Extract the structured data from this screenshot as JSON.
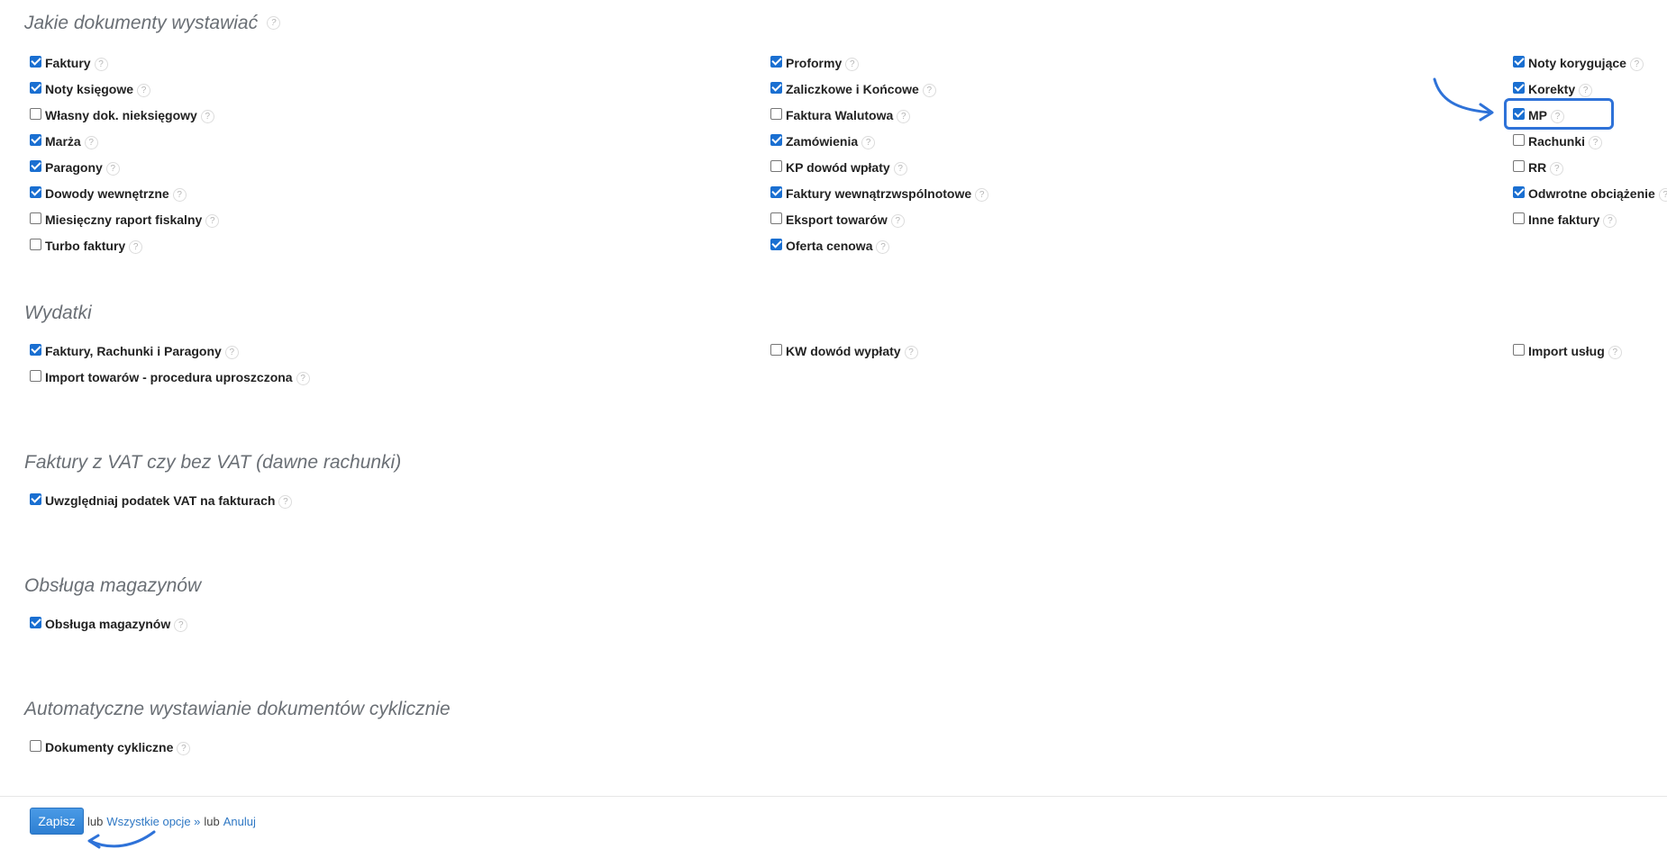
{
  "help_glyph": "?",
  "accent_color": "#1a6fd1",
  "documents": {
    "title": "Jakie dokumenty wystawiać",
    "col1": [
      {
        "label": "Faktury",
        "checked": true
      },
      {
        "label": "Noty księgowe",
        "checked": true
      },
      {
        "label": "Własny dok. nieksięgowy",
        "checked": false
      },
      {
        "label": "Marża",
        "checked": true
      },
      {
        "label": "Paragony",
        "checked": true
      },
      {
        "label": "Dowody wewnętrzne",
        "checked": true
      },
      {
        "label": "Miesięczny raport fiskalny",
        "checked": false
      },
      {
        "label": "Turbo faktury",
        "checked": false
      }
    ],
    "col2": [
      {
        "label": "Proformy",
        "checked": true
      },
      {
        "label": "Zaliczkowe i Końcowe",
        "checked": true
      },
      {
        "label": "Faktura Walutowa",
        "checked": false
      },
      {
        "label": "Zamówienia",
        "checked": true
      },
      {
        "label": "KP dowód wpłaty",
        "checked": false
      },
      {
        "label": "Faktury wewnątrzwspólnotowe",
        "checked": true
      },
      {
        "label": "Eksport towarów",
        "checked": false
      },
      {
        "label": "Oferta cenowa",
        "checked": true
      }
    ],
    "col3": [
      {
        "label": "Noty korygujące",
        "checked": true
      },
      {
        "label": "Korekty",
        "checked": true
      },
      {
        "label": "MP",
        "checked": true
      },
      {
        "label": "Rachunki",
        "checked": false
      },
      {
        "label": "RR",
        "checked": false
      },
      {
        "label": "Odwrotne obciążenie",
        "checked": true
      },
      {
        "label": "Inne faktury",
        "checked": false
      }
    ]
  },
  "expenses": {
    "title": "Wydatki",
    "col1": [
      {
        "label": "Faktury, Rachunki i Paragony",
        "checked": true
      },
      {
        "label": "Import towarów - procedura uproszczona",
        "checked": false
      }
    ],
    "col2": [
      {
        "label": "KW dowód wypłaty",
        "checked": false
      }
    ],
    "col3": [
      {
        "label": "Import usług",
        "checked": false
      }
    ]
  },
  "vat": {
    "title": "Faktury z VAT czy bez VAT (dawne rachunki)",
    "items": [
      {
        "label": "Uwzględniaj podatek VAT na fakturach",
        "checked": true
      }
    ]
  },
  "warehouse": {
    "title": "Obsługa magazynów",
    "items": [
      {
        "label": "Obsługa magazynów",
        "checked": true
      }
    ]
  },
  "cyclic": {
    "title": "Automatyczne wystawianie dokumentów cyklicznie",
    "items": [
      {
        "label": "Dokumenty cykliczne",
        "checked": false
      }
    ]
  },
  "footer": {
    "save_label": "Zapisz",
    "or1": "lub",
    "all_options_label": "Wszystkie opcje »",
    "or2": "lub",
    "cancel_label": "Anuluj"
  }
}
